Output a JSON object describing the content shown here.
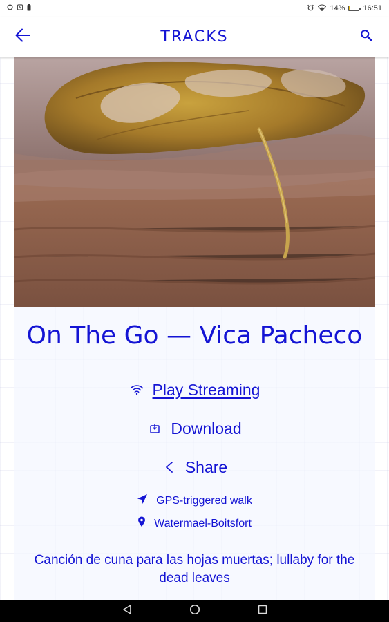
{
  "status_bar": {
    "battery_percent": "14%",
    "battery_level": 0.14,
    "time": "16:51",
    "icons": [
      "circle-icon",
      "nfc-icon",
      "battery-saver-icon",
      "alarm-icon",
      "wifi-icon",
      "battery-icon"
    ]
  },
  "app_bar": {
    "title": "TRACKS",
    "back_icon": "arrow-left-icon",
    "search_icon": "search-icon"
  },
  "track": {
    "title": "On The Go — Vica Pacheco",
    "cover_image": "leaf-on-water-photo",
    "actions": [
      {
        "label": "Play Streaming",
        "icon": "wifi-icon"
      },
      {
        "label": "Download",
        "icon": "download-icon"
      },
      {
        "label": "Share",
        "icon": "share-icon"
      }
    ],
    "meta": [
      {
        "label": "GPS-triggered walk",
        "icon": "navigation-arrow-icon"
      },
      {
        "label": "Watermael-Boitsfort",
        "icon": "location-pin-icon"
      }
    ],
    "description": "Canción de cuna para las hojas muertas; lullaby for the dead leaves"
  },
  "nav_bar": {
    "back": "back-triangle-icon",
    "home": "home-circle-icon",
    "recents": "recents-square-icon"
  },
  "colors": {
    "accent": "#1414d4",
    "nav_bar": "#000000",
    "battery": "#e8b81a"
  }
}
